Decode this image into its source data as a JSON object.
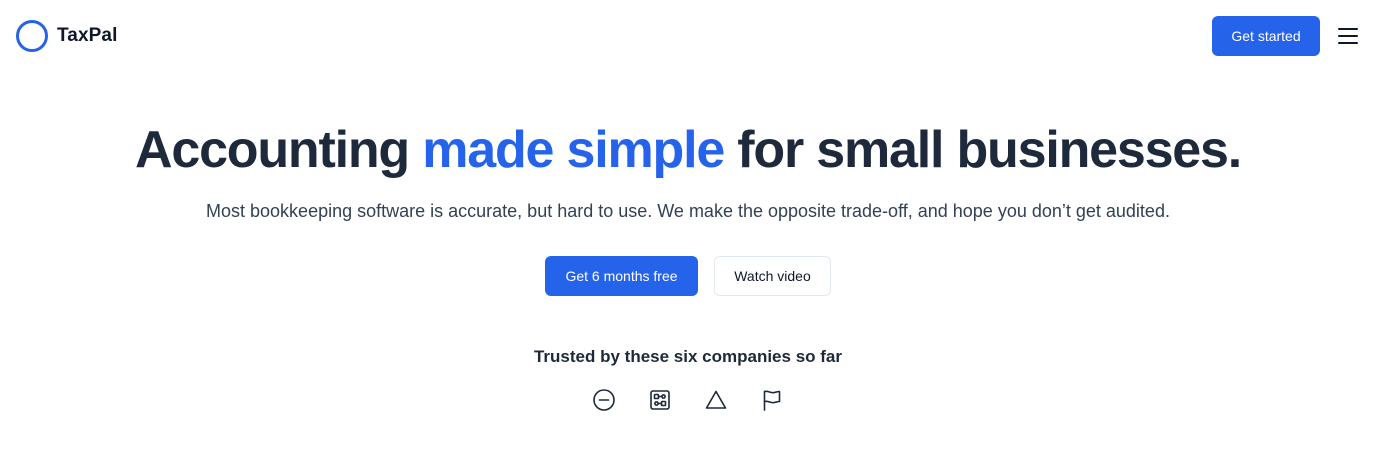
{
  "header": {
    "brand": "TaxPal",
    "get_started_label": "Get started",
    "menu_icon": "hamburger-menu-icon"
  },
  "hero": {
    "title_before": "Accounting ",
    "title_accent": "made simple",
    "title_after": " for small businesses.",
    "subtitle": "Most bookkeeping software is accurate, but hard to use. We make the opposite trade-off, and hope you don’t get audited.",
    "primary_cta": "Get 6 months free",
    "secondary_cta": "Watch video"
  },
  "trusted": {
    "heading": "Trusted by these six companies so far",
    "logos": [
      "minus-circle-icon",
      "circuit-box-icon",
      "triangle-icon",
      "flag-icon"
    ]
  },
  "colors": {
    "accent": "#2563eb",
    "heading": "#1e293b",
    "body_text": "#334155",
    "border": "#e2e8f0"
  }
}
